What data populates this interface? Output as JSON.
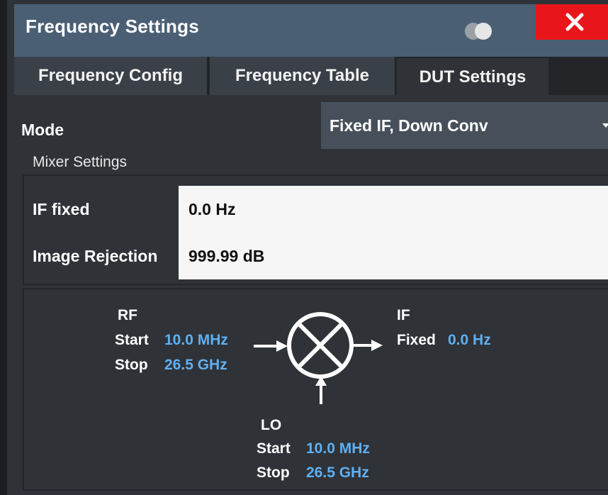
{
  "window": {
    "title": "Frequency Settings"
  },
  "tabs": [
    {
      "label": "Frequency Config"
    },
    {
      "label": "Frequency Table"
    },
    {
      "label": "DUT Settings"
    }
  ],
  "mode": {
    "label": "Mode",
    "value": "Fixed IF, Down Conv"
  },
  "mixer_settings": {
    "title": "Mixer Settings",
    "if_fixed": {
      "label": "IF fixed",
      "value": "0.0 Hz"
    },
    "image_rejection": {
      "label": "Image Rejection",
      "value": "999.99 dB"
    }
  },
  "diagram": {
    "rf": {
      "title": "RF",
      "start_label": "Start",
      "start_value": "10.0 MHz",
      "stop_label": "Stop",
      "stop_value": "26.5 GHz"
    },
    "if": {
      "title": "IF",
      "fixed_label": "Fixed",
      "fixed_value": "0.0 Hz"
    },
    "lo": {
      "title": "LO",
      "start_label": "Start",
      "start_value": "10.0 MHz",
      "stop_label": "Stop",
      "stop_value": "26.5 GHz"
    }
  },
  "icons": {
    "toggle": "toggle-icon",
    "close": "close-icon",
    "mixer": "mixer-symbol-icon",
    "caret": "chevron-down-icon"
  },
  "colors": {
    "title_bar": "#4a5f74",
    "close_button": "#e8161b",
    "value_highlight": "#5fb0f2",
    "input_background": "#f6f6f6"
  }
}
